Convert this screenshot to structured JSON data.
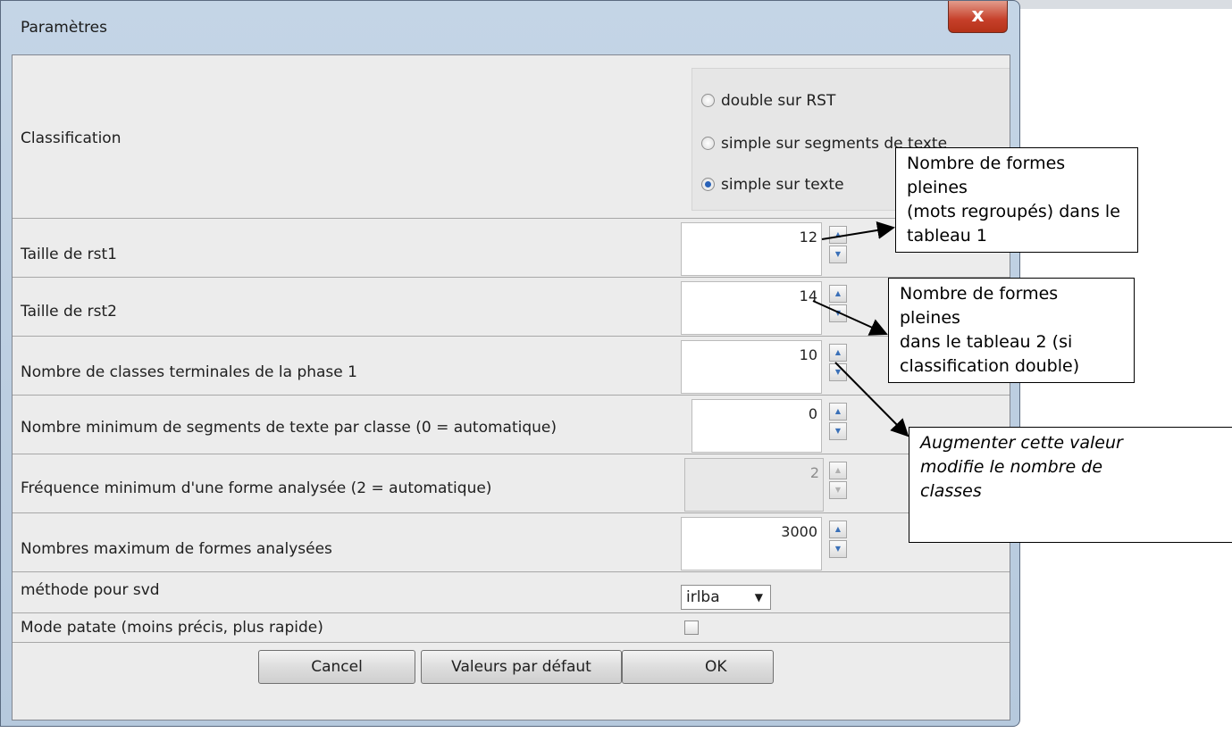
{
  "window": {
    "title": "Paramètres",
    "close_label": "x"
  },
  "classification": {
    "label": "Classification",
    "options": [
      "double sur RST",
      "simple sur segments de texte",
      "simple sur texte"
    ],
    "selected_index": 2
  },
  "params": {
    "rst1": {
      "label": "Taille de rst1",
      "value": "12"
    },
    "rst2": {
      "label": "Taille de rst2",
      "value": "14"
    },
    "terminal": {
      "label": "Nombre de classes terminales de la phase 1",
      "value": "10"
    },
    "min_segments": {
      "label": "Nombre minimum de segments de texte par classe (0 = automatique)",
      "value": "0"
    },
    "min_freq": {
      "label": "Fréquence minimum d'une forme analysée (2 = automatique)",
      "value": "2"
    },
    "max_forms": {
      "label": "Nombres maximum de formes analysées",
      "value": "3000"
    },
    "svd": {
      "label": "méthode pour svd",
      "value": "irlba"
    },
    "patate": {
      "label": "Mode patate (moins précis, plus rapide)",
      "checked": false
    }
  },
  "buttons": {
    "cancel": "Cancel",
    "defaults": "Valeurs par défaut",
    "ok": "OK"
  },
  "annotations": {
    "a1": [
      "Nombre de formes pleines",
      "(mots regroupés) dans le",
      "tableau 1"
    ],
    "a2": [
      "Nombre de formes pleines",
      "dans le tableau 2 (si",
      "classification double)"
    ],
    "a3": [
      "Augmenter cette valeur",
      "modifie le nombre de",
      "classes"
    ]
  },
  "colors": {
    "frame": "#b6c9dd",
    "client": "#ececec",
    "close": "#c6402a",
    "radio_selected": "#2a62b8"
  }
}
